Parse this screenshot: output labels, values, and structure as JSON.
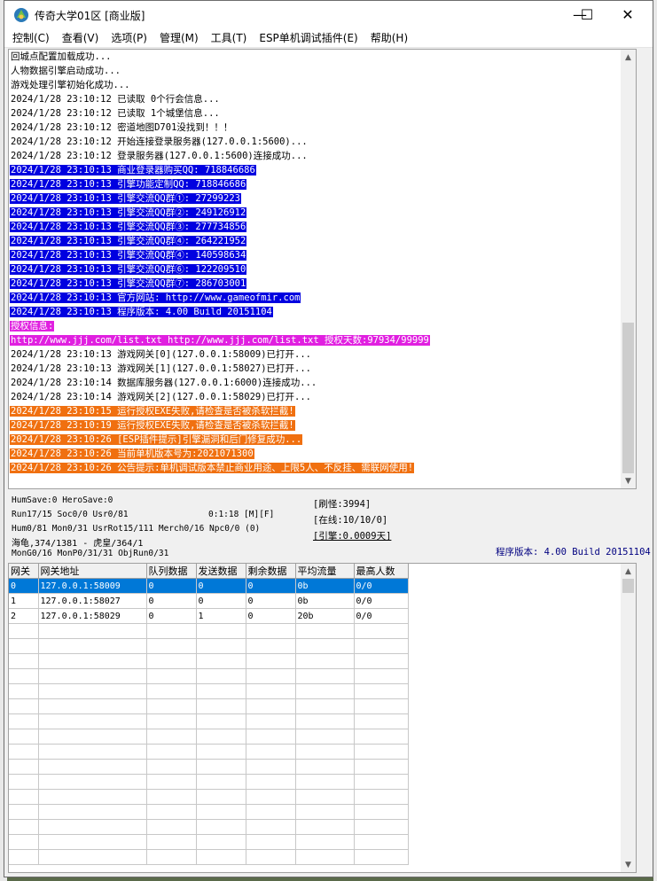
{
  "window": {
    "title": "传奇大学01区 [商业版]",
    "minimize": "—",
    "maximize": "☐",
    "close": "✕"
  },
  "menu": [
    "控制(C)",
    "查看(V)",
    "选项(P)",
    "管理(M)",
    "工具(T)",
    "ESP单机调试插件(E)",
    "帮助(H)"
  ],
  "log": [
    {
      "text": "回城点配置加载成功...",
      "color": "#000000",
      "bg": ""
    },
    {
      "text": "人物数据引擎启动成功...",
      "color": "#000000",
      "bg": ""
    },
    {
      "text": "游戏处理引擎初始化成功...",
      "color": "#000000",
      "bg": ""
    },
    {
      "text": "2024/1/28 23:10:12 已读取 0个行会信息...",
      "color": "#000000",
      "bg": ""
    },
    {
      "text": "2024/1/28 23:10:12 已读取 1个城堡信息...",
      "color": "#000000",
      "bg": ""
    },
    {
      "text": "2024/1/28 23:10:12 密道地图D701没找到！！！",
      "color": "#000000",
      "bg": ""
    },
    {
      "text": "2024/1/28 23:10:12 开始连接登录服务器(127.0.0.1:5600)...",
      "color": "#000000",
      "bg": ""
    },
    {
      "text": "2024/1/28 23:10:12 登录服务器(127.0.0.1:5600)连接成功...",
      "color": "#000000",
      "bg": ""
    },
    {
      "text": "2024/1/28 23:10:13 商业登录器购买QQ: 718846686",
      "color": "#ffffff",
      "bg": "#0000e0"
    },
    {
      "text": "2024/1/28 23:10:13 引擎功能定制QQ: 718846686",
      "color": "#ffffff",
      "bg": "#0000e0"
    },
    {
      "text": "2024/1/28 23:10:13 引擎交流QQ群①: 27299223",
      "color": "#ffffff",
      "bg": "#0000e0"
    },
    {
      "text": "2024/1/28 23:10:13 引擎交流QQ群②: 249126912",
      "color": "#ffffff",
      "bg": "#0000e0"
    },
    {
      "text": "2024/1/28 23:10:13 引擎交流QQ群③: 277734856",
      "color": "#ffffff",
      "bg": "#0000e0"
    },
    {
      "text": "2024/1/28 23:10:13 引擎交流QQ群④: 264221952",
      "color": "#ffffff",
      "bg": "#0000e0"
    },
    {
      "text": "2024/1/28 23:10:13 引擎交流QQ群④: 140598634",
      "color": "#ffffff",
      "bg": "#0000e0"
    },
    {
      "text": "2024/1/28 23:10:13 引擎交流QQ群⑥: 122209510",
      "color": "#ffffff",
      "bg": "#0000e0"
    },
    {
      "text": "2024/1/28 23:10:13 引擎交流QQ群⑦: 286703001",
      "color": "#ffffff",
      "bg": "#0000e0"
    },
    {
      "text": "2024/1/28 23:10:13 官方网站: http://www.gameofmir.com",
      "color": "#ffffff",
      "bg": "#0000e0"
    },
    {
      "text": "2024/1/28 23:10:13 程序版本: 4.00 Build 20151104",
      "color": "#ffffff",
      "bg": "#0000e0"
    },
    {
      "text": "授权信息:",
      "color": "#ffffff",
      "bg": "#e020e0"
    },
    {
      "text": "http://www.jjj.com/list.txt http://www.jjj.com/list.txt 授权天数:97934/99999",
      "color": "#ffffff",
      "bg": "#e020e0"
    },
    {
      "text": "2024/1/28 23:10:13 游戏网关[0](127.0.0.1:58009)已打开...",
      "color": "#000000",
      "bg": ""
    },
    {
      "text": "2024/1/28 23:10:13 游戏网关[1](127.0.0.1:58027)已打开...",
      "color": "#000000",
      "bg": ""
    },
    {
      "text": "2024/1/28 23:10:14 数据库服务器(127.0.0.1:6000)连接成功...",
      "color": "#000000",
      "bg": ""
    },
    {
      "text": "2024/1/28 23:10:14 游戏网关[2](127.0.0.1:58029)已打开...",
      "color": "#000000",
      "bg": ""
    },
    {
      "text": "2024/1/28 23:10:15 运行授权EXE失败,请检查是否被杀软拦截!",
      "color": "#ffffff",
      "bg": "#f07010"
    },
    {
      "text": "2024/1/28 23:10:19 运行授权EXE失败,请检查是否被杀软拦截!",
      "color": "#ffffff",
      "bg": "#f07010"
    },
    {
      "text": "2024/1/28 23:10:26 [ESP插件提示]引擎漏洞和后门修复成功...",
      "color": "#ffffff",
      "bg": "#f07010"
    },
    {
      "text": "2024/1/28 23:10:26 当前单机版本号为:2021071300",
      "color": "#ffffff",
      "bg": "#f07010"
    },
    {
      "text": "2024/1/28 23:10:26 公告提示:单机调试版本禁止商业用途、上限5人、不反挂、需联网使用!",
      "color": "#ffffff",
      "bg": "#f07010"
    }
  ],
  "status": {
    "line1": "HumSave:0 HeroSave:0",
    "line2a": "Run17/15 Soc0/0 Usr0/81",
    "line2b": "0:1:18 [M][F]",
    "line3": "Hum0/81 Mon0/31 UsrRot15/111 Merch0/16 Npc0/0 (0)",
    "line4": "海龟,374/1381 - 虎皇/364/1",
    "line5": "MonG0/16 MonP0/31/31 ObjRun0/31",
    "refresh": "[刷怪:3994]",
    "online": "[在线:10/10/0]",
    "engine": "[引擎:0.0009天]",
    "version": "程序版本: 4.00 Build 20151104"
  },
  "grid": {
    "columns": [
      "网关",
      "网关地址",
      "队列数据",
      "发送数据",
      "剩余数据",
      "平均流量",
      "最高人数"
    ],
    "rows": [
      [
        "0",
        "127.0.0.1:58009",
        "0",
        "0",
        "0",
        "0b",
        "0/0"
      ],
      [
        "1",
        "127.0.0.1:58027",
        "0",
        "0",
        "0",
        "0b",
        "0/0"
      ],
      [
        "2",
        "127.0.0.1:58029",
        "0",
        "1",
        "0",
        "20b",
        "0/0"
      ]
    ],
    "selected_row": 0
  }
}
